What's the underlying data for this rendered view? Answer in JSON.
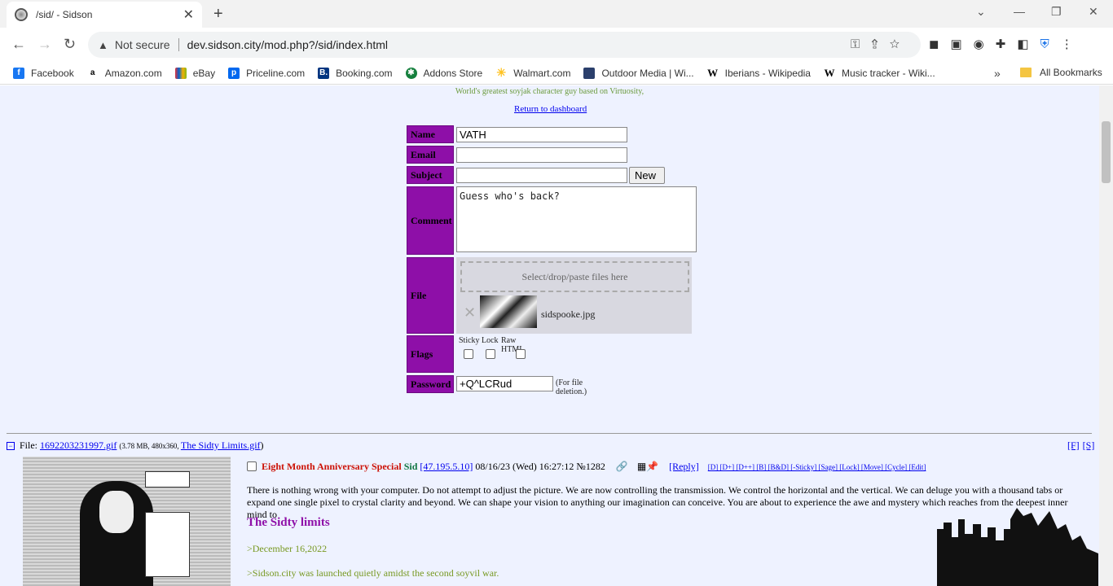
{
  "browser": {
    "tab_title": "/sid/ - Sidson",
    "security_label": "Not secure",
    "url": "dev.sidson.city/mod.php?/sid/index.html",
    "bookmarks": [
      "Facebook",
      "Amazon.com",
      "eBay",
      "Priceline.com",
      "Booking.com",
      "Addons Store",
      "Walmart.com",
      "Outdoor Media | Wi...",
      "Iberians - Wikipedia",
      "Music tracker - Wiki..."
    ],
    "bookmark_more": "»",
    "all_bookmarks": "All Bookmarks"
  },
  "header": {
    "subtitle": "World's greatest soyjak character guy based on Virtuosity,",
    "return_link": "Return to dashboard"
  },
  "form": {
    "name_label": "Name",
    "name_value": "VATH",
    "email_label": "Email",
    "subject_label": "Subject",
    "submit_label": "New Topic",
    "comment_label": "Comment",
    "comment_value": "Guess who's back?",
    "file_label": "File",
    "dropzone_text": "Select/drop/paste files here",
    "attached_file": "sidspooke.jpg",
    "flags_label": "Flags",
    "flags": [
      "Sticky",
      "Lock",
      "Raw HTML"
    ],
    "password_label": "Password",
    "password_value": "+Q^LCRud",
    "password_note": "(For file deletion.)"
  },
  "thread": {
    "file_prefix": "File: ",
    "file_link": "1692203231997.gif",
    "file_meta": "(3.78 MB, 480x360, ",
    "file_orig": "The Sidty Limits.gif",
    "file_close": ")",
    "f_link": "[F]",
    "s_link": "[S]",
    "subject": "Eight Month Anniversary Special",
    "name": "Sid",
    "ip": "[47.195.5.10]",
    "date": "08/16/23 (Wed) 16:27:12",
    "post_no": "№1282",
    "reply": "[Reply]",
    "mod_actions": "[D] [D+] [D++] [B] [B&D] [-Sticky] [Sage] [Lock] [Move] [Cycle] [Edit]",
    "body": "There is nothing wrong with your computer. Do not attempt to adjust the picture. We are now controlling the transmission. We control the horizontal and the vertical. We can deluge you with a thousand tabs or expand one single pixel to crystal clarity and beyond. We can shape your vision to anything our imagination can conceive. You are about to experience the awe and mystery which reaches from the deepest inner mind to",
    "heading": "The Sidty limits",
    "quote1": ">December 16,2022",
    "quote2": ">Sidson.city was launched quietly amidst the second soyvil war."
  }
}
